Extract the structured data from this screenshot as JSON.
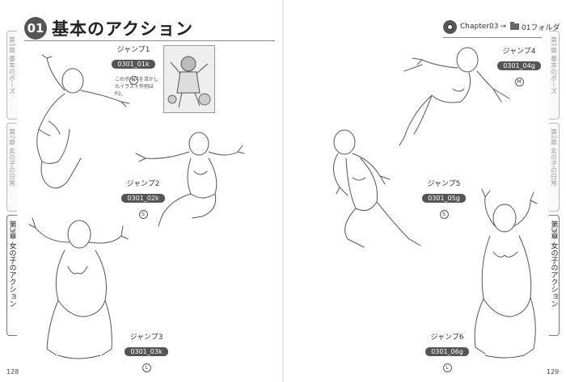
{
  "header": {
    "number": "01",
    "title": "基本のアクション",
    "chapter": "Chapter03",
    "arrow": "→",
    "folder": "01フォルダ"
  },
  "tabs": {
    "left": [
      {
        "label": "第1章 基本のポーズ",
        "active": false
      },
      {
        "label": "第2章 女の子の日常",
        "active": false
      },
      {
        "label": "第3章 女の子のアクション",
        "active": true
      }
    ],
    "right": [
      {
        "label": "第1章 基本のポーズ",
        "active": false
      },
      {
        "label": "第2章 女の子の日常",
        "active": false
      },
      {
        "label": "第3章 女の子のアクション",
        "active": true
      }
    ]
  },
  "poses": [
    {
      "name": "ジャンプ1",
      "code": "0301_01k",
      "size": "M"
    },
    {
      "name": "ジャンプ2",
      "code": "0301_02k",
      "size": "S"
    },
    {
      "name": "ジャンプ3",
      "code": "0301_03k",
      "size": "L"
    },
    {
      "name": "ジャンプ4",
      "code": "0301_04g",
      "size": "M"
    },
    {
      "name": "ジャンプ5",
      "code": "0301_05g",
      "size": "S"
    },
    {
      "name": "ジャンプ6",
      "code": "0301_06g",
      "size": "L"
    }
  ],
  "note": "このポーズを活かしたイラスト作例はP2。",
  "pages": {
    "left": "128",
    "right": "129"
  }
}
